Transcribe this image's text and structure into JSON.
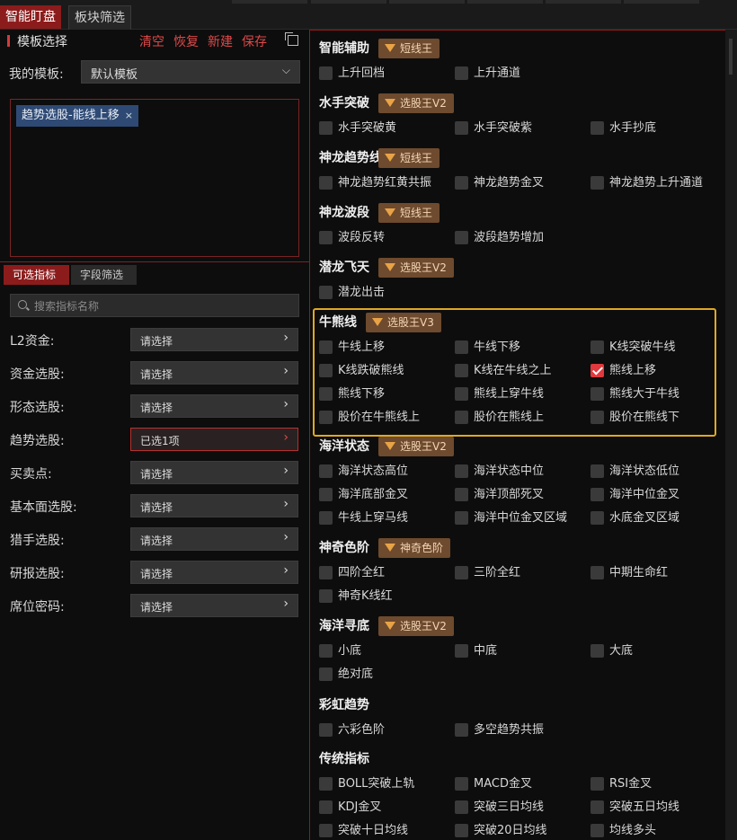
{
  "tabs": [
    {
      "label": "智能盯盘",
      "active": true
    },
    {
      "label": "板块筛选",
      "active": false
    }
  ],
  "left": {
    "header_title": "模板选择",
    "actions": [
      "清空",
      "恢复",
      "新建",
      "保存"
    ],
    "my_template_label": "我的模板:",
    "template_select": "默认模板",
    "selected_tag": "趋势选股-能线上移",
    "subtabs": [
      {
        "label": "可选指标",
        "active": true
      },
      {
        "label": "字段筛选",
        "active": false
      }
    ],
    "search_placeholder": "搜索指标名称",
    "filters": [
      {
        "label": "L2资金:",
        "value": "请选择",
        "selected": false
      },
      {
        "label": "资金选股:",
        "value": "请选择",
        "selected": false
      },
      {
        "label": "形态选股:",
        "value": "请选择",
        "selected": false
      },
      {
        "label": "趋势选股:",
        "value": "已选1项",
        "selected": true
      },
      {
        "label": "买卖点:",
        "value": "请选择",
        "selected": false
      },
      {
        "label": "基本面选股:",
        "value": "请选择",
        "selected": false
      },
      {
        "label": "猎手选股:",
        "value": "请选择",
        "selected": false
      },
      {
        "label": "研报选股:",
        "value": "请选择",
        "selected": false
      },
      {
        "label": "席位密码:",
        "value": "请选择",
        "selected": false
      }
    ]
  },
  "groups": [
    {
      "title": "智能辅助",
      "badge": "短线王",
      "items": [
        "上升回档",
        "上升通道"
      ]
    },
    {
      "title": "水手突破",
      "badge": "选股王V2",
      "items": [
        "水手突破黄",
        "水手突破紫",
        "水手抄底"
      ]
    },
    {
      "title": "神龙趋势线",
      "badge": "短线王",
      "items": [
        "神龙趋势红黄共振",
        "神龙趋势金叉",
        "神龙趋势上升通道"
      ]
    },
    {
      "title": "神龙波段",
      "badge": "短线王",
      "items": [
        "波段反转",
        "波段趋势增加"
      ]
    },
    {
      "title": "潜龙飞天",
      "badge": "选股王V2",
      "items": [
        "潜龙出击"
      ]
    },
    {
      "title": "牛熊线",
      "badge": "选股王V3",
      "items": [
        "牛线上移",
        "牛线下移",
        "K线突破牛线",
        "K线跌破熊线",
        "K线在牛线之上",
        "熊线上移",
        "熊线下移",
        "熊线上穿牛线",
        "熊线大于牛线",
        "股价在牛熊线上",
        "股价在熊线上",
        "股价在熊线下"
      ],
      "checked": [
        5
      ]
    },
    {
      "title": "海洋状态",
      "badge": "选股王V2",
      "items": [
        "海洋状态高位",
        "海洋状态中位",
        "海洋状态低位",
        "海洋底部金叉",
        "海洋顶部死叉",
        "海洋中位金叉",
        "牛线上穿马线",
        "海洋中位金叉区域",
        "水底金叉区域"
      ]
    },
    {
      "title": "神奇色阶",
      "badge": "神奇色阶",
      "items": [
        "四阶全红",
        "三阶全红",
        "中期生命红",
        "神奇K线红"
      ]
    },
    {
      "title": "海洋寻底",
      "badge": "选股王V2",
      "items": [
        "小底",
        "中底",
        "大底",
        "绝对底"
      ]
    },
    {
      "title": "彩虹趋势",
      "badge": "",
      "items": [
        "六彩色阶",
        "多空趋势共振"
      ]
    },
    {
      "title": "传统指标",
      "badge": "",
      "items": [
        "BOLL突破上轨",
        "MACD金叉",
        "RSI金叉",
        "KDJ金叉",
        "突破三日均线",
        "突破五日均线",
        "突破十日均线",
        "突破20日均线",
        "均线多头"
      ]
    }
  ],
  "colors": {
    "accent": "#8c1c1c",
    "action_red": "#e04848",
    "highlight": "#e0a822",
    "badge_bg": "#6e4a2e"
  }
}
